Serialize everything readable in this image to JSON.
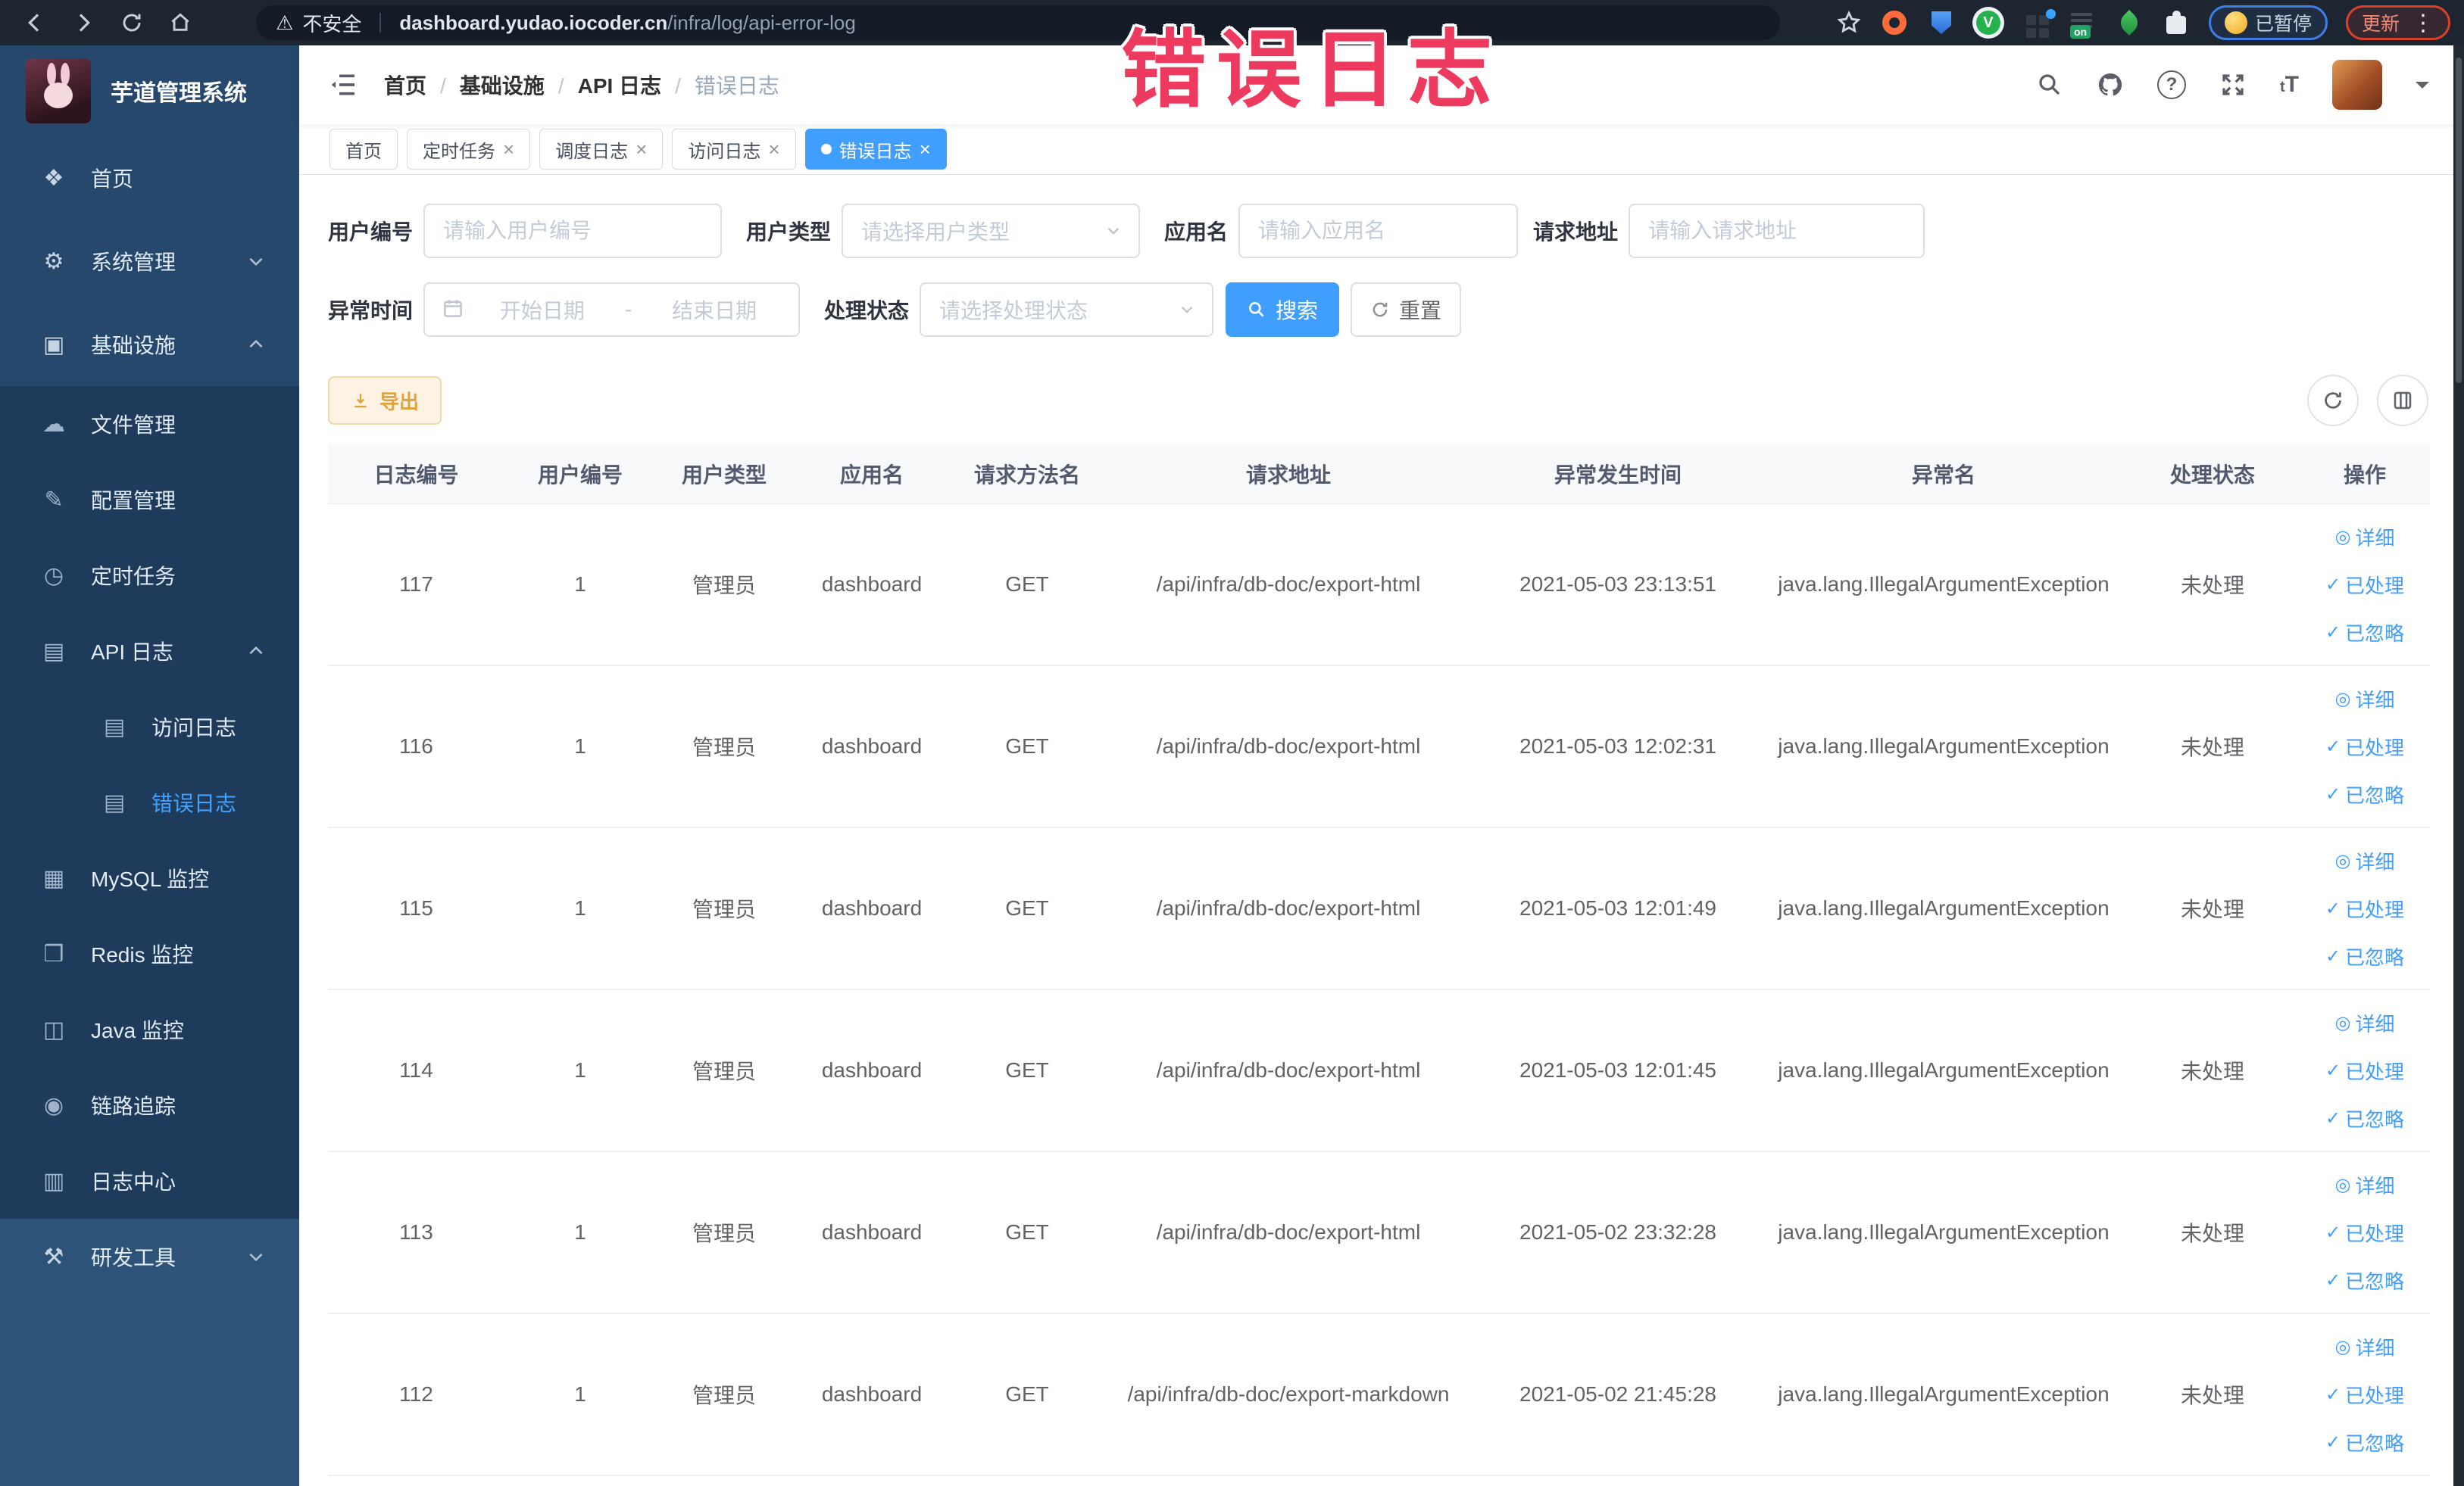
{
  "watermark": "错误日志",
  "colors": {
    "accent": "#409eff",
    "watermark": "#ee3a5e",
    "warning_button": "#e6a23c",
    "sidebar_bg": "#2e5378",
    "sidebar_submenu_bg": "#1e3b5c",
    "chrome_bg": "#1d2531",
    "paused_border": "#3d7ee8",
    "update_border": "#d8402b"
  },
  "browser": {
    "security_label": "不安全",
    "url_host": "dashboard.yudao.iocoder.cn",
    "url_path": "/infra/log/api-error-log",
    "paused_label": "已暂停",
    "update_label": "更新",
    "nav_icons": [
      "back-icon",
      "forward-icon",
      "reload-icon",
      "home-icon",
      "warning-icon"
    ],
    "extension_icons": [
      "bookmark-star-icon",
      "adblock-extension-icon",
      "shield-extension-icon",
      "green-v-extension-icon",
      "grid-extension-icon",
      "switch-on-extension-icon",
      "leaf-extension-icon",
      "puzzle-extension-icon",
      "emoji-face-icon",
      "browser-menu-icon"
    ]
  },
  "sidebar": {
    "app_title": "芋道管理系统",
    "items": [
      {
        "label": "首页",
        "icon": "dashboard-icon"
      },
      {
        "label": "系统管理",
        "icon": "gear-icon",
        "chevron_down": true
      },
      {
        "label": "基础设施",
        "icon": "infra-icon",
        "chevron_up": true
      },
      {
        "label": "文件管理",
        "icon": "file-icon",
        "sub": true
      },
      {
        "label": "配置管理",
        "icon": "config-icon",
        "sub": true
      },
      {
        "label": "定时任务",
        "icon": "job-icon",
        "sub": true
      },
      {
        "label": "API 日志",
        "icon": "api-log-icon",
        "sub": true,
        "chevron_up": true
      },
      {
        "label": "访问日志",
        "icon": "access-log-icon",
        "sub": true,
        "child": true
      },
      {
        "label": "错误日志",
        "icon": "error-log-icon",
        "sub": true,
        "child": true,
        "active": true
      },
      {
        "label": "MySQL 监控",
        "icon": "mysql-icon",
        "sub": true
      },
      {
        "label": "Redis 监控",
        "icon": "redis-icon",
        "sub": true
      },
      {
        "label": "Java 监控",
        "icon": "java-icon",
        "sub": true
      },
      {
        "label": "链路追踪",
        "icon": "trace-icon",
        "sub": true
      },
      {
        "label": "日志中心",
        "icon": "log-center-icon",
        "sub": true
      },
      {
        "label": "研发工具",
        "icon": "tools-icon",
        "chevron_down": true
      }
    ]
  },
  "navbar": {
    "breadcrumb": [
      "首页",
      "基础设施",
      "API 日志",
      "错误日志"
    ],
    "icons": [
      "search-icon",
      "github-icon",
      "help-icon",
      "fullscreen-icon",
      "font-size-icon",
      "avatar",
      "caret-down-icon"
    ]
  },
  "tags": [
    {
      "label": "首页",
      "closable": false,
      "active": false
    },
    {
      "label": "定时任务",
      "closable": true,
      "active": false
    },
    {
      "label": "调度日志",
      "closable": true,
      "active": false
    },
    {
      "label": "访问日志",
      "closable": true,
      "active": false
    },
    {
      "label": "错误日志",
      "closable": true,
      "active": true
    }
  ],
  "filters": {
    "user_id": {
      "label": "用户编号",
      "placeholder": "请输入用户编号"
    },
    "user_type": {
      "label": "用户类型",
      "placeholder": "请选择用户类型"
    },
    "app_name": {
      "label": "应用名",
      "placeholder": "请输入应用名"
    },
    "request_url": {
      "label": "请求地址",
      "placeholder": "请输入请求地址"
    },
    "exception_time": {
      "label": "异常时间",
      "start_placeholder": "开始日期",
      "separator": "-",
      "end_placeholder": "结束日期"
    },
    "process_status": {
      "label": "处理状态",
      "placeholder": "请选择处理状态"
    },
    "search_label": "搜索",
    "reset_label": "重置"
  },
  "toolbar": {
    "export_label": "导出",
    "icons": [
      "refresh-icon",
      "columns-icon"
    ]
  },
  "table": {
    "columns": [
      "日志编号",
      "用户编号",
      "用户类型",
      "应用名",
      "请求方法名",
      "请求地址",
      "异常发生时间",
      "异常名",
      "处理状态",
      "操作"
    ],
    "row_actions": [
      {
        "label": "详细",
        "icon": "eye-icon"
      },
      {
        "label": "已处理",
        "icon": "check-icon"
      },
      {
        "label": "已忽略",
        "icon": "check-icon"
      }
    ],
    "rows": [
      {
        "cells": [
          "117",
          "1",
          "管理员",
          "dashboard",
          "GET",
          "/api/infra/db-doc/export-html",
          "2021-05-03 23:13:51",
          "java.lang.IllegalArgumentException",
          "未处理"
        ]
      },
      {
        "cells": [
          "116",
          "1",
          "管理员",
          "dashboard",
          "GET",
          "/api/infra/db-doc/export-html",
          "2021-05-03 12:02:31",
          "java.lang.IllegalArgumentException",
          "未处理"
        ]
      },
      {
        "cells": [
          "115",
          "1",
          "管理员",
          "dashboard",
          "GET",
          "/api/infra/db-doc/export-html",
          "2021-05-03 12:01:49",
          "java.lang.IllegalArgumentException",
          "未处理"
        ]
      },
      {
        "cells": [
          "114",
          "1",
          "管理员",
          "dashboard",
          "GET",
          "/api/infra/db-doc/export-html",
          "2021-05-03 12:01:45",
          "java.lang.IllegalArgumentException",
          "未处理"
        ]
      },
      {
        "cells": [
          "113",
          "1",
          "管理员",
          "dashboard",
          "GET",
          "/api/infra/db-doc/export-html",
          "2021-05-02 23:32:28",
          "java.lang.IllegalArgumentException",
          "未处理"
        ]
      },
      {
        "cells": [
          "112",
          "1",
          "管理员",
          "dashboard",
          "GET",
          "/api/infra/db-doc/export-markdown",
          "2021-05-02 21:45:28",
          "java.lang.IllegalArgumentException",
          "未处理"
        ]
      }
    ]
  }
}
